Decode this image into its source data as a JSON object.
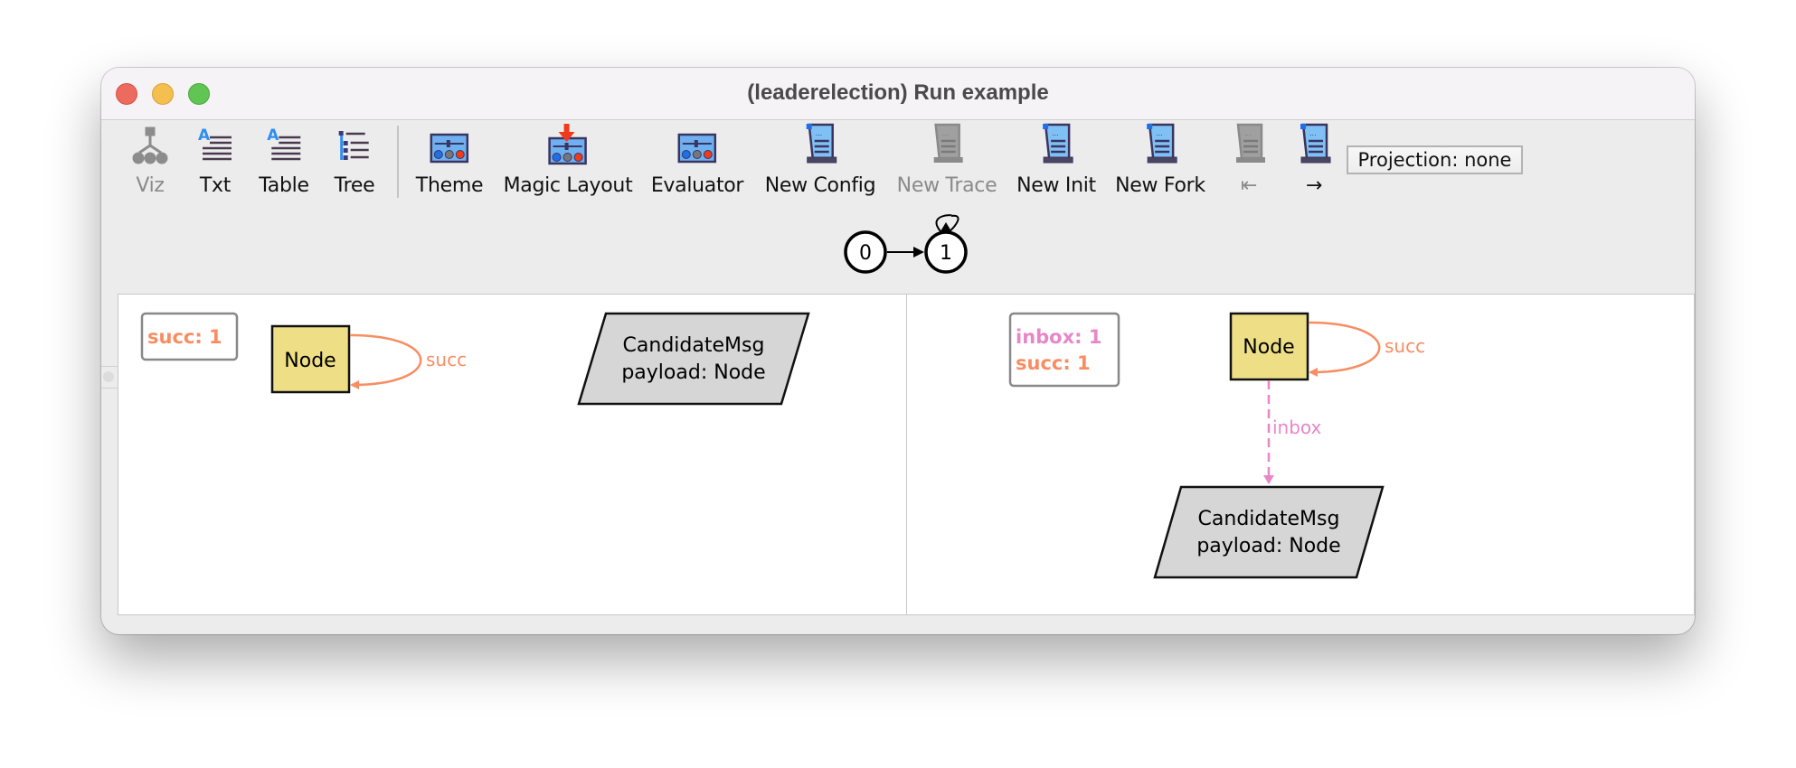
{
  "window": {
    "title": "(leaderelection) Run example"
  },
  "toolbar": {
    "buttons": [
      {
        "label": "Viz",
        "icon": "tree-graph-icon",
        "enabled": false
      },
      {
        "label": "Txt",
        "icon": "text-icon",
        "enabled": true
      },
      {
        "label": "Table",
        "icon": "table-icon",
        "enabled": true
      },
      {
        "label": "Tree",
        "icon": "tree-list-icon",
        "enabled": true
      },
      {
        "label": "Theme",
        "icon": "theme-sliders-icon",
        "enabled": true
      },
      {
        "label": "Magic Layout",
        "icon": "magic-layout-icon",
        "enabled": true
      },
      {
        "label": "Evaluator",
        "icon": "evaluator-icon",
        "enabled": true
      },
      {
        "label": "New Config",
        "icon": "scroll-icon",
        "enabled": true
      },
      {
        "label": "New Trace",
        "icon": "scroll-icon",
        "enabled": false
      },
      {
        "label": "New Init",
        "icon": "scroll-icon",
        "enabled": true
      },
      {
        "label": "New Fork",
        "icon": "scroll-icon",
        "enabled": true
      },
      {
        "label": "⇤",
        "icon": "scroll-icon",
        "enabled": false
      },
      {
        "label": "→",
        "icon": "scroll-icon",
        "enabled": true
      }
    ],
    "projection": "Projection: none"
  },
  "state_graph": {
    "nodes": [
      "0",
      "1"
    ],
    "edges": [
      [
        "0",
        "1"
      ],
      [
        "1",
        "1"
      ]
    ]
  },
  "colors": {
    "succ": "#f88d62",
    "inbox": "#e887c7",
    "node_fill": "#eedf86",
    "msg_fill": "#d6d6d6"
  },
  "panels": {
    "left": {
      "legend": [
        {
          "text": "succ: 1",
          "kind": "succ"
        }
      ],
      "node_label": "Node",
      "self_edge_label": "succ",
      "message": {
        "line1": "CandidateMsg",
        "line2": "payload: Node"
      }
    },
    "right": {
      "legend": [
        {
          "text": "inbox: 1",
          "kind": "inbox"
        },
        {
          "text": "succ: 1",
          "kind": "succ"
        }
      ],
      "node_label": "Node",
      "self_edge_label": "succ",
      "edge_label": "inbox",
      "message": {
        "line1": "CandidateMsg",
        "line2": "payload: Node"
      }
    }
  }
}
